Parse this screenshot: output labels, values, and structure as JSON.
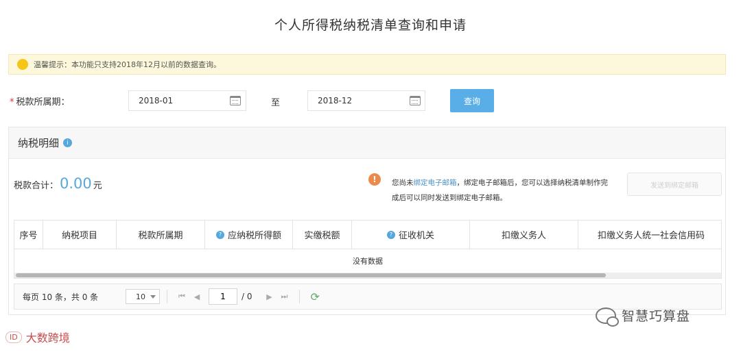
{
  "page": {
    "title": "个人所得税纳税清单查询和申请"
  },
  "notice": {
    "text": "温馨提示：本功能只支持2018年12月以前的数据查询。",
    "icon": "lightbulb-icon"
  },
  "query_form": {
    "period_label": "税款所属期：",
    "required_mark": "*",
    "start_value": "2018-01",
    "to_label": "至",
    "end_value": "2018-12",
    "submit_label": "查询"
  },
  "details": {
    "title": "纳税明细",
    "total_label": "税款合计：",
    "total_amount": "0.00",
    "total_unit": "元",
    "warning": {
      "prefix": "您尚未",
      "link": "绑定电子邮箱",
      "suffix": "，绑定电子邮箱后，您可以选择纳税清单制作完成后可以同时发送到绑定电子邮箱。"
    },
    "send_button_label": "发送到绑定邮箱",
    "columns": [
      "序号",
      "纳税项目",
      "税款所属期",
      "应纳税所得额",
      "实缴税额",
      "征收机关",
      "扣缴义务人",
      "扣缴义务人统一社会信用码"
    ],
    "empty_text": "没有数据"
  },
  "pagination": {
    "info": "每页 10 条，共 0 条",
    "page_size": "10",
    "current_page": "1",
    "total_pages": "/ 0",
    "first_glyph": "⏮",
    "prev_glyph": "◀",
    "next_glyph": "▶",
    "last_glyph": "⏭",
    "refresh_glyph": "⟳"
  },
  "watermarks": {
    "right": "智慧巧算盘",
    "left_badge": "ID",
    "left": "大数跨境"
  },
  "colors": {
    "accent": "#5aaee8",
    "notice_bg": "#fdf8dc",
    "warning": "#ec8a4c"
  }
}
